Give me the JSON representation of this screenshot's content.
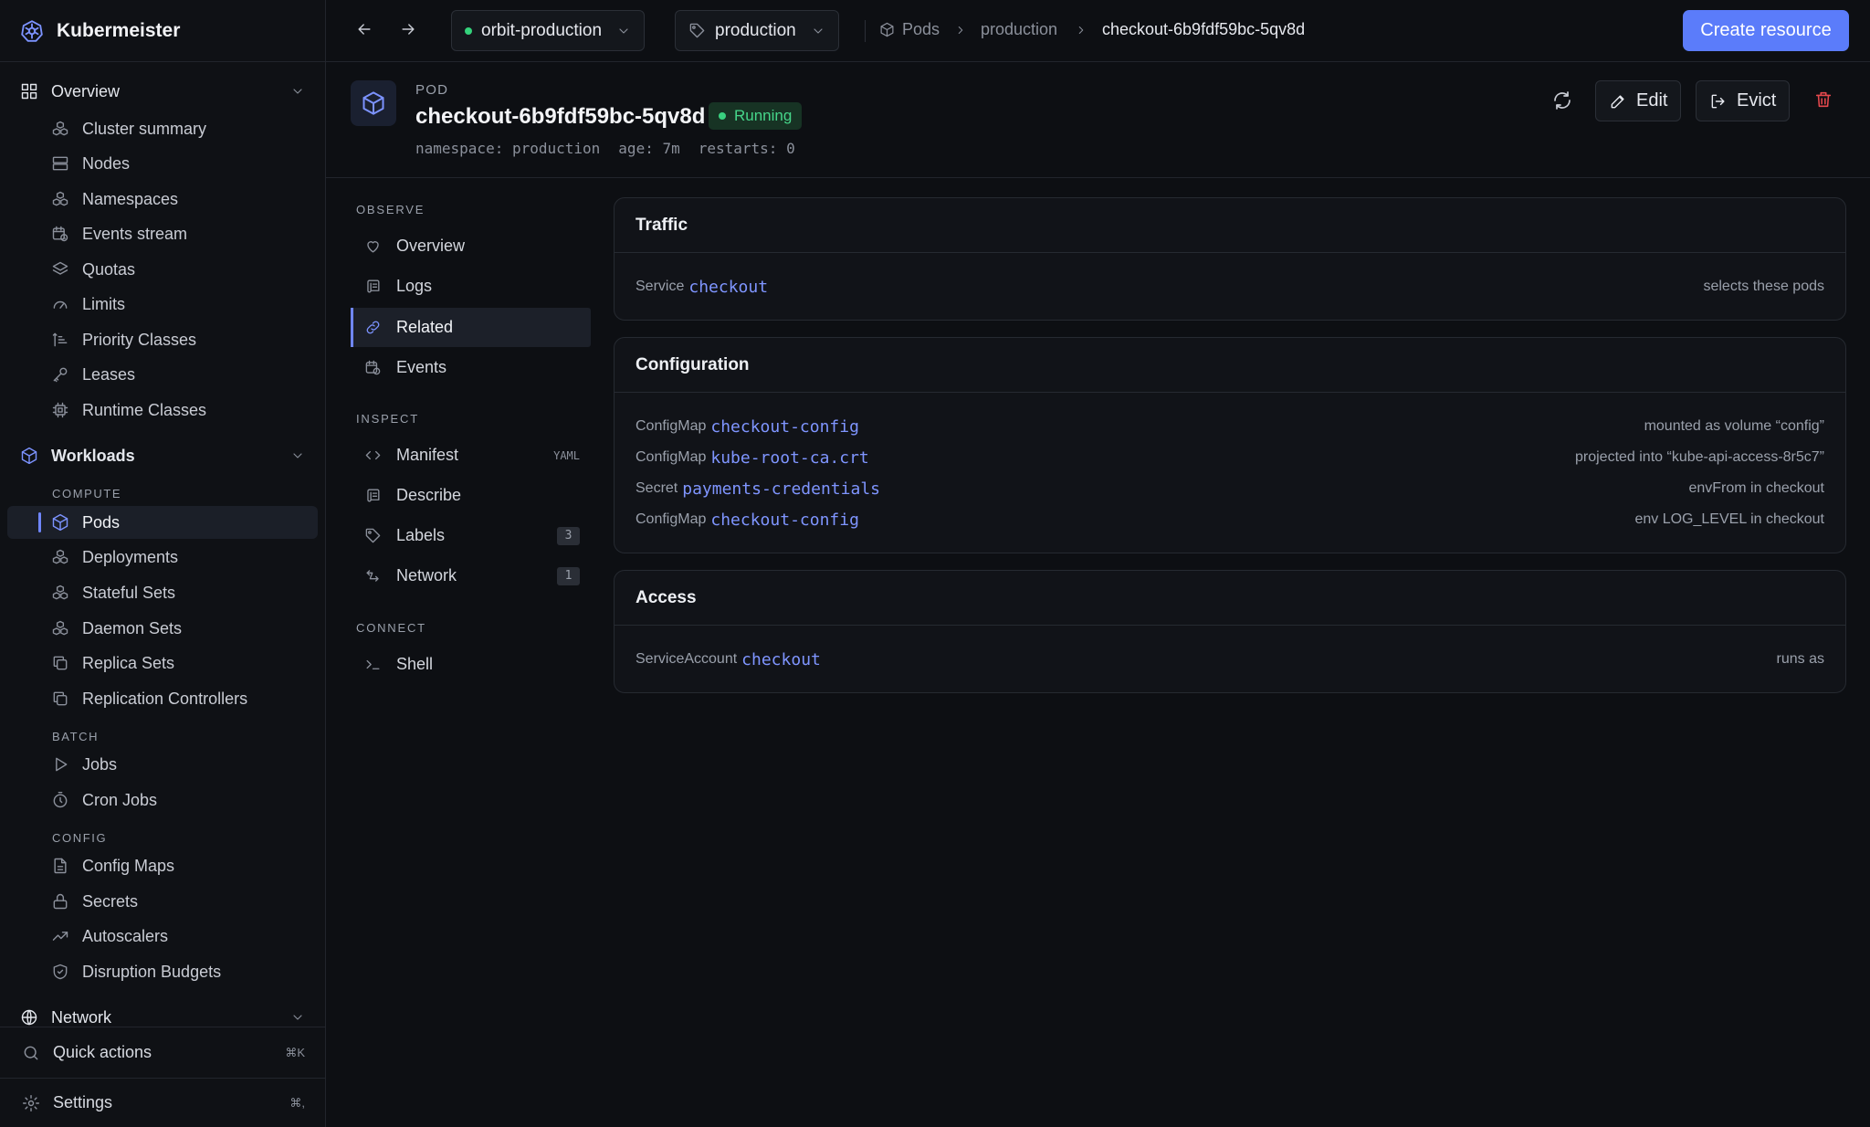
{
  "app": {
    "name": "Kubermeister"
  },
  "sidebar": {
    "overview": {
      "label": "Overview",
      "items": [
        "Cluster summary",
        "Nodes",
        "Namespaces",
        "Events stream",
        "Quotas",
        "Limits",
        "Priority Classes",
        "Leases",
        "Runtime Classes"
      ]
    },
    "workloads": {
      "label": "Workloads",
      "compute_label": "COMPUTE",
      "compute": [
        "Pods",
        "Deployments",
        "Stateful Sets",
        "Daemon Sets",
        "Replica Sets",
        "Replication Controllers"
      ],
      "batch_label": "BATCH",
      "batch": [
        "Jobs",
        "Cron Jobs"
      ],
      "config_label": "CONFIG",
      "config": [
        "Config Maps",
        "Secrets",
        "Autoscalers",
        "Disruption Budgets"
      ]
    },
    "network": {
      "label": "Network"
    },
    "quick_actions": {
      "label": "Quick actions",
      "shortcut": "⌘K"
    },
    "settings": {
      "label": "Settings",
      "shortcut": "⌘,"
    }
  },
  "topbar": {
    "cluster": "orbit-production",
    "namespace": "production",
    "breadcrumbs": [
      "Pods",
      "production",
      "checkout-6b9fdf59bc-5qv8d"
    ],
    "create_label": "Create resource"
  },
  "pod": {
    "kind": "POD",
    "name": "checkout-6b9fdf59bc-5qv8d",
    "status": "Running",
    "namespace": "namespace: production",
    "age": "age: 7m",
    "restarts": "restarts: 0",
    "edit_label": "Edit",
    "evict_label": "Evict"
  },
  "subnav": {
    "observe_label": "OBSERVE",
    "observe": [
      "Overview",
      "Logs",
      "Related",
      "Events"
    ],
    "inspect_label": "INSPECT",
    "manifest": {
      "label": "Manifest",
      "tag": "YAML"
    },
    "describe": {
      "label": "Describe"
    },
    "labels": {
      "label": "Labels",
      "count": "3"
    },
    "network": {
      "label": "Network",
      "count": "1"
    },
    "connect_label": "CONNECT",
    "shell": {
      "label": "Shell"
    }
  },
  "cards": {
    "traffic": {
      "title": "Traffic",
      "rows": [
        {
          "kind": "Service",
          "ref": "checkout",
          "note": "selects these pods"
        }
      ]
    },
    "configuration": {
      "title": "Configuration",
      "rows": [
        {
          "kind": "ConfigMap",
          "ref": "checkout-config",
          "note": "mounted as volume “config”"
        },
        {
          "kind": "ConfigMap",
          "ref": "kube-root-ca.crt",
          "note": "projected into “kube-api-access-8r5c7”"
        },
        {
          "kind": "Secret",
          "ref": "payments-credentials",
          "note": "envFrom in checkout"
        },
        {
          "kind": "ConfigMap",
          "ref": "checkout-config",
          "note": "env LOG_LEVEL in checkout"
        }
      ]
    },
    "access": {
      "title": "Access",
      "rows": [
        {
          "kind": "ServiceAccount",
          "ref": "checkout",
          "note": "runs as"
        }
      ]
    }
  },
  "colors": {
    "accent": "#5b7cfa",
    "link": "#7f95ff",
    "running": "#46d68a",
    "danger": "#e5484d"
  }
}
